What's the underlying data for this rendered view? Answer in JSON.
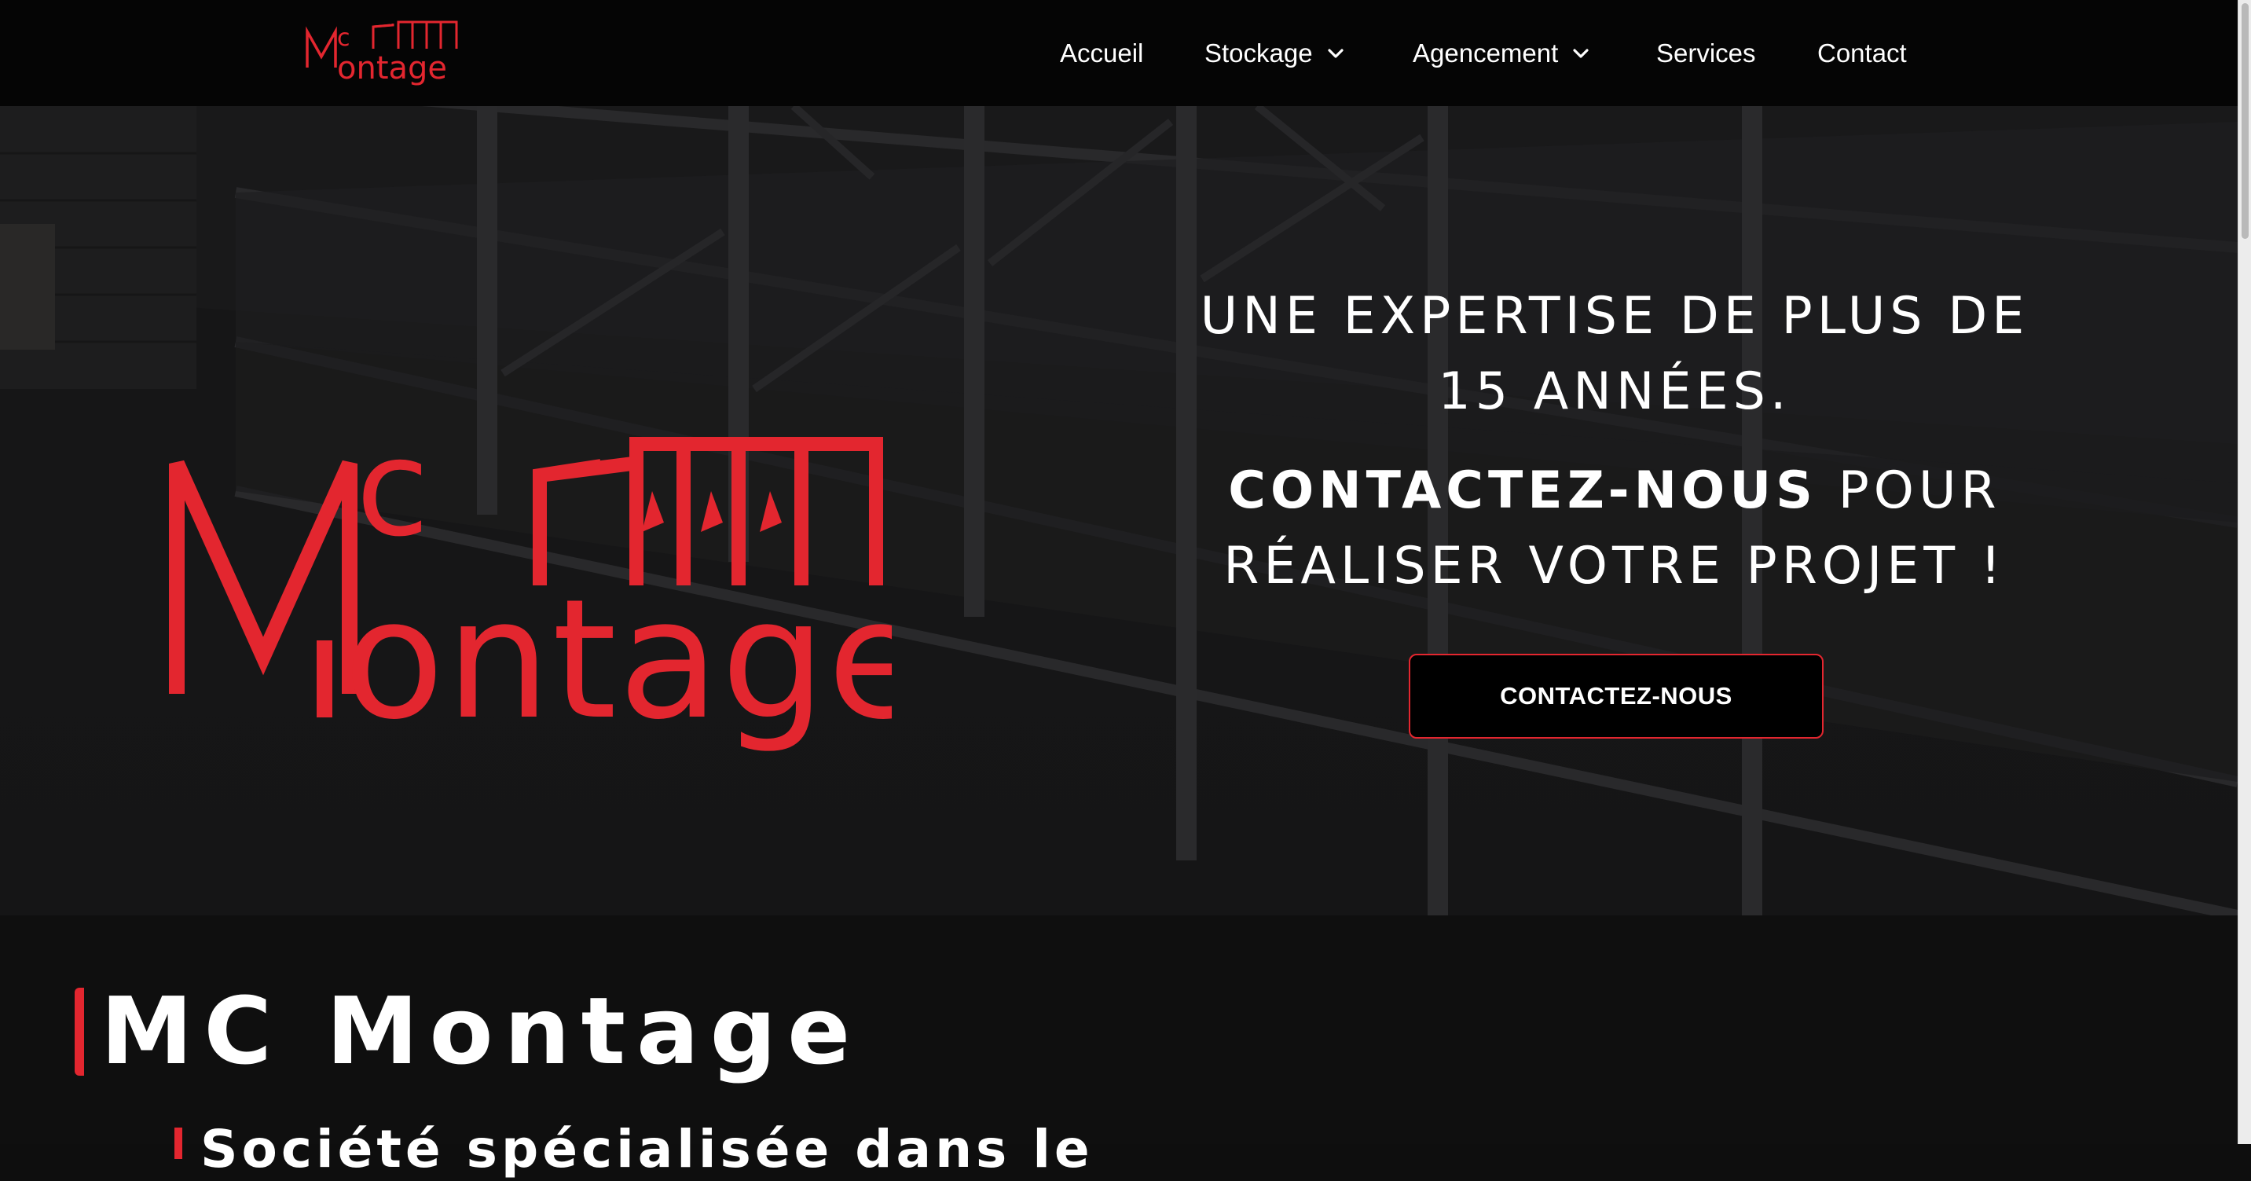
{
  "brand": {
    "logo_line1": "Mc",
    "logo_line2": "ontage",
    "accent_color": "#e3262f"
  },
  "nav": {
    "items": [
      {
        "label": "Accueil",
        "has_dropdown": false
      },
      {
        "label": "Stockage",
        "has_dropdown": true
      },
      {
        "label": "Agencement",
        "has_dropdown": true
      },
      {
        "label": "Services",
        "has_dropdown": false
      },
      {
        "label": "Contact",
        "has_dropdown": false
      }
    ],
    "dropdown_icon": "chevron-down-icon"
  },
  "hero": {
    "headline": "Une expertise de plus de 15 années.",
    "cta_bold": "Contactez-nous",
    "cta_rest": " pour réaliser votre projet !",
    "button_label": "CONTACTEZ-NOUS",
    "background_image": "warehouse shelving racks"
  },
  "about": {
    "title": "MC Montage",
    "subtitle": "Société spécialisée dans le"
  }
}
